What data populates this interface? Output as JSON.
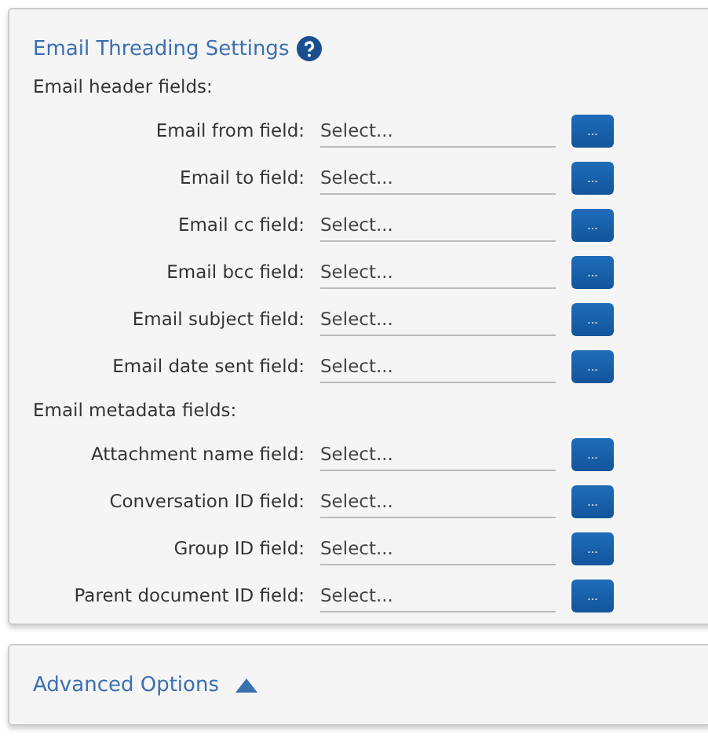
{
  "settings_panel": {
    "title": "Email Threading Settings",
    "groups": [
      {
        "heading": "Email header fields:",
        "fields": [
          {
            "label": "Email from field:",
            "placeholder": "Select...",
            "button": "..."
          },
          {
            "label": "Email to field:",
            "placeholder": "Select...",
            "button": "..."
          },
          {
            "label": "Email cc field:",
            "placeholder": "Select...",
            "button": "..."
          },
          {
            "label": "Email bcc field:",
            "placeholder": "Select...",
            "button": "..."
          },
          {
            "label": "Email subject field:",
            "placeholder": "Select...",
            "button": "..."
          },
          {
            "label": "Email date sent field:",
            "placeholder": "Select...",
            "button": "..."
          }
        ]
      },
      {
        "heading": "Email metadata fields:",
        "fields": [
          {
            "label": "Attachment name field:",
            "placeholder": "Select...",
            "button": "..."
          },
          {
            "label": "Conversation ID field:",
            "placeholder": "Select...",
            "button": "..."
          },
          {
            "label": "Group ID field:",
            "placeholder": "Select...",
            "button": "..."
          },
          {
            "label": "Parent document ID field:",
            "placeholder": "Select...",
            "button": "..."
          }
        ]
      }
    ]
  },
  "advanced_panel": {
    "title": "Advanced Options"
  }
}
